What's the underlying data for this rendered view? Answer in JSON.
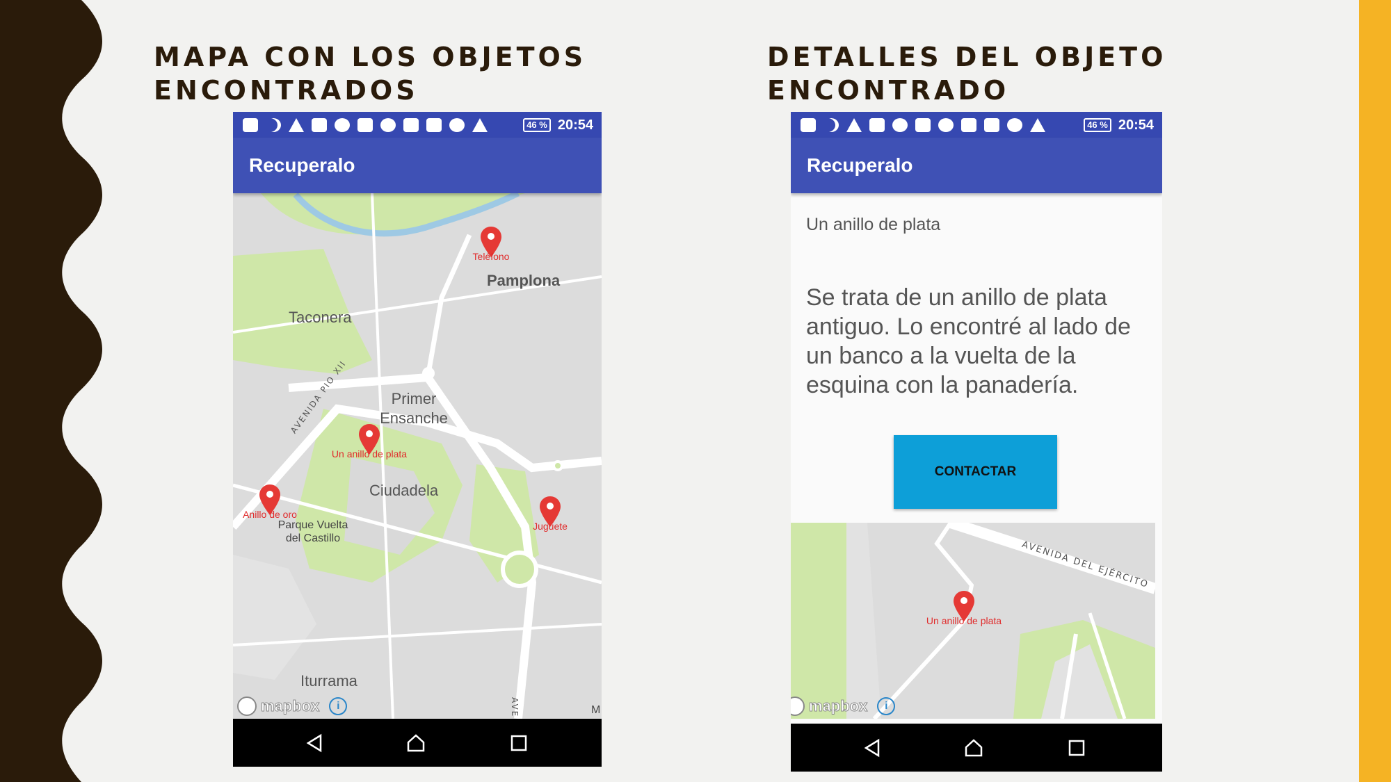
{
  "slide": {
    "left_heading": "MAPA CON LOS OBJETOS ENCONTRADOS",
    "right_heading": "DETALLES DEL OBJETO ENCONTRADO",
    "accent_color": "#f5b324",
    "wave_color": "#2a1b0a"
  },
  "status_bar": {
    "battery": "46 %",
    "time": "20:54",
    "color": "#3648b1"
  },
  "app": {
    "title": "Recuperalo",
    "color": "#3f51b5"
  },
  "map_screen": {
    "places": [
      "Pamplona",
      "Taconera",
      "Primer Ensanche",
      "Ciudadela",
      "Parque Vuelta del Castillo",
      "Iturrama",
      "M"
    ],
    "street": "AVENIDA PIO XII",
    "street_short": "AVE",
    "markers": [
      "Teléfono",
      "Un anillo de plata",
      "Anillo de oro",
      "Juguete"
    ],
    "attribution": "mapbox"
  },
  "detail_screen": {
    "object_title": "Un anillo de plata",
    "description": "Se trata de un anillo de plata antiguo. Lo encontré al lado de un banco a la vuelta de la esquina con la panadería.",
    "contact_label": "CONTACTAR",
    "map_street": "AVENIDA DEL EJÉRCITO",
    "map_marker": "Un anillo de plata",
    "attribution": "mapbox",
    "button_color": "#0d9fd8"
  },
  "icons": [
    "back-icon",
    "home-icon",
    "recent-apps-icon",
    "map-marker-icon",
    "info-icon"
  ]
}
